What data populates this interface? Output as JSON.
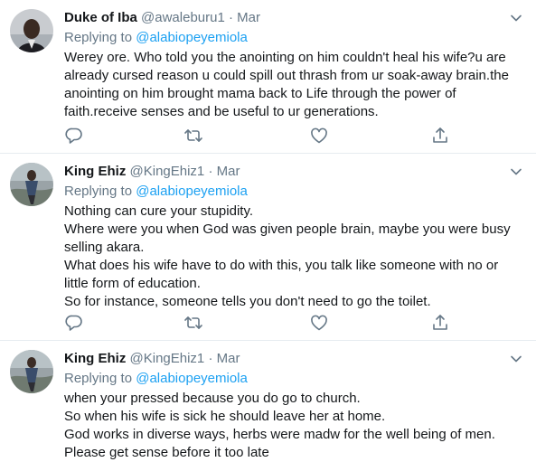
{
  "tweets": [
    {
      "author_name": "Duke of Iba",
      "handle": "@awaleburu1",
      "separator": "·",
      "date": "Mar",
      "replying_prefix": "Replying to",
      "replying_mention": "@alabiopeyemiola",
      "lines": [
        "Werey ore. Who told you the anointing on him couldn't heal his wife?u are",
        "already cursed reason u could spill out thrash from ur soak-away brain.the",
        "anointing on him brought mama back to Life through the power of",
        "faith.receive senses and be useful to ur generations."
      ]
    },
    {
      "author_name": "King Ehiz",
      "handle": "@KingEhiz1",
      "separator": "·",
      "date": "Mar",
      "replying_prefix": "Replying to",
      "replying_mention": "@alabiopeyemiola",
      "lines": [
        "Nothing can cure your stupidity.",
        "Where were you when God was given people brain, maybe you were busy",
        "selling akara.",
        "What does his wife have to do with this, you talk like someone with no or",
        "little form of education.",
        "So for instance, someone tells you don't need to go the toilet."
      ]
    },
    {
      "author_name": "King Ehiz",
      "handle": "@KingEhiz1",
      "separator": "·",
      "date": "Mar",
      "replying_prefix": "Replying to",
      "replying_mention": "@alabiopeyemiola",
      "lines": [
        "when your pressed  because you do go to church.",
        "So when his wife is sick he should leave her at home.",
        "God works in diverse ways, herbs were madw for the well being of men.",
        "Please get sense before it too late"
      ]
    }
  ],
  "icons": {
    "reply": "reply-icon",
    "retweet": "retweet-icon",
    "like": "like-icon",
    "share": "share-icon",
    "caret": "chevron-down-icon"
  },
  "colors": {
    "text": "#14171a",
    "muted": "#657786",
    "link": "#1da1f2",
    "divider": "#e6ecf0"
  }
}
